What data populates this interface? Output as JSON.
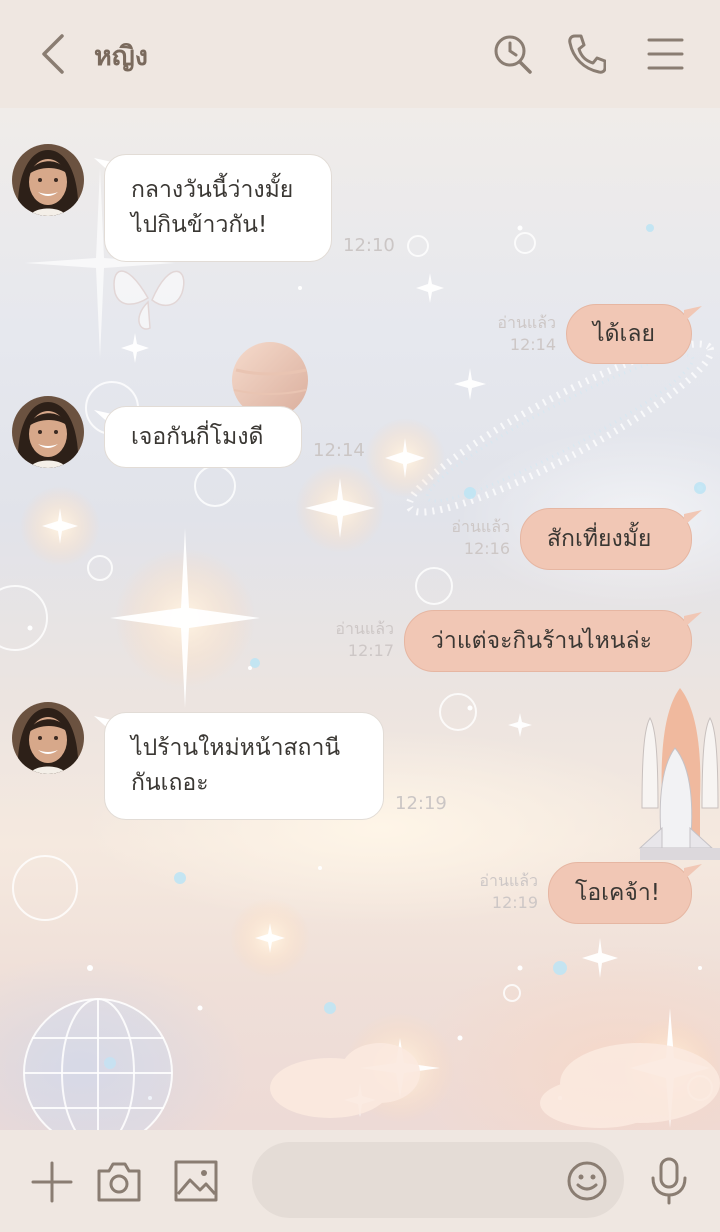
{
  "header": {
    "title": "หญิง",
    "icons": [
      "back-chevron-icon",
      "search-history-icon",
      "phone-icon",
      "menu-icon"
    ]
  },
  "messages": [
    {
      "side": "in",
      "lines": [
        "กลางวันนี้ว่างมั้ย",
        "ไปกินข้าวกัน!"
      ],
      "time": "12:10"
    },
    {
      "side": "out",
      "text": "ได้เลย",
      "read": "อ่านแล้ว",
      "time": "12:14"
    },
    {
      "side": "in",
      "lines": [
        "เจอกันกี่โมงดี"
      ],
      "time": "12:14"
    },
    {
      "side": "out",
      "text": "สักเที่ยงมั้ย",
      "read": "อ่านแล้ว",
      "time": "12:16"
    },
    {
      "side": "out",
      "text": "ว่าแต่จะกินร้านไหนล่ะ",
      "read": "อ่านแล้ว",
      "time": "12:17"
    },
    {
      "side": "in",
      "lines": [
        "ไปร้านใหม่หน้าสถานี",
        "กันเถอะ"
      ],
      "time": "12:19"
    },
    {
      "side": "out",
      "text": "โอเคจ้า!",
      "read": "อ่านแล้ว",
      "time": "12:19"
    }
  ],
  "footer": {
    "input_value": "",
    "icons": [
      "plus-icon",
      "camera-icon",
      "image-icon",
      "emoji-icon",
      "microphone-icon"
    ]
  },
  "colors": {
    "header_bg": "#efe7e1",
    "incoming_bubble": "#ffffff",
    "outgoing_bubble": "#f1c7b5",
    "icon_color": "#8a7d72"
  }
}
